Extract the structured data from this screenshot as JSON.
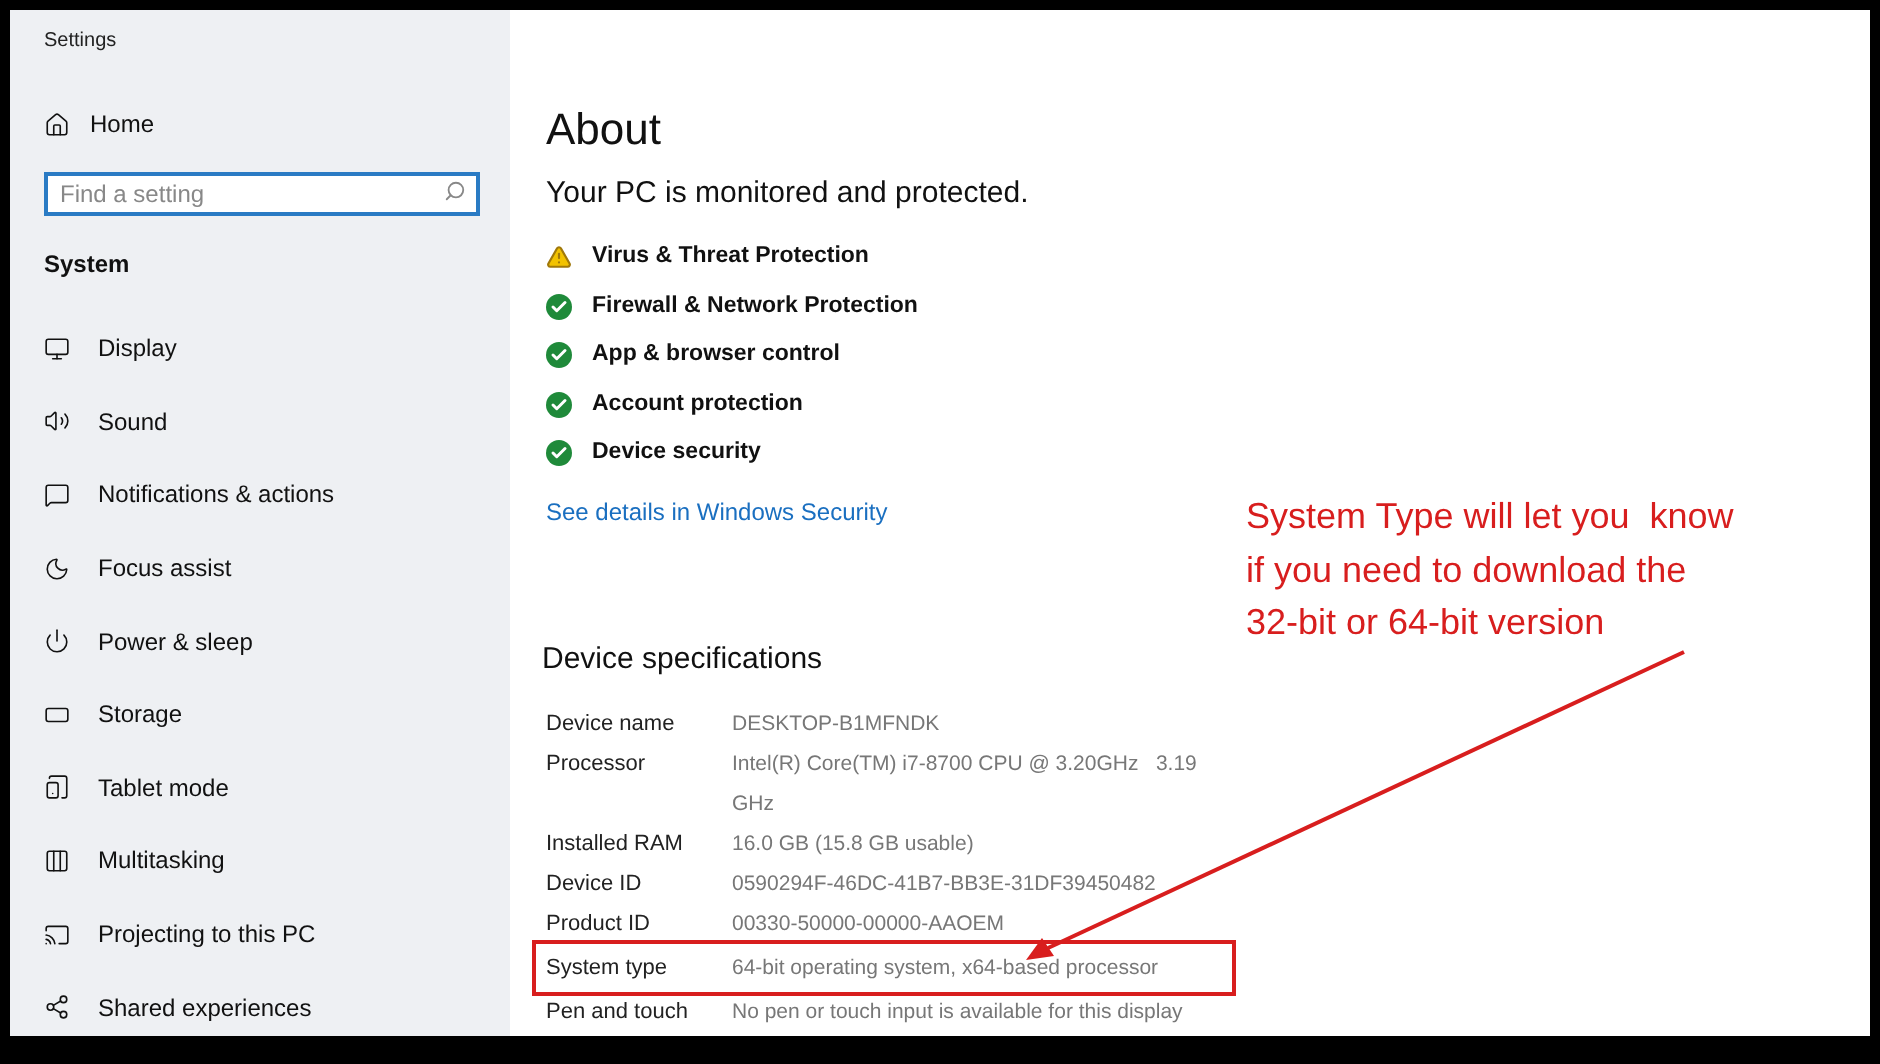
{
  "window": {
    "title": "Settings"
  },
  "sidebar": {
    "home": "Home",
    "search": {
      "placeholder": "Find a setting"
    },
    "section": "System",
    "items": [
      {
        "label": "Display"
      },
      {
        "label": "Sound"
      },
      {
        "label": "Notifications & actions"
      },
      {
        "label": "Focus assist"
      },
      {
        "label": "Power & sleep"
      },
      {
        "label": "Storage"
      },
      {
        "label": "Tablet mode"
      },
      {
        "label": "Multitasking"
      },
      {
        "label": "Projecting to this PC"
      },
      {
        "label": "Shared experiences"
      }
    ]
  },
  "main": {
    "title": "About",
    "status": "Your PC is monitored and protected.",
    "security": [
      {
        "label": "Virus & Threat Protection",
        "kind": "warning"
      },
      {
        "label": "Firewall & Network Protection",
        "kind": "ok"
      },
      {
        "label": "App & browser control",
        "kind": "ok"
      },
      {
        "label": "Account protection",
        "kind": "ok"
      },
      {
        "label": "Device security",
        "kind": "ok"
      }
    ],
    "link": "See details in Windows Security",
    "specs_title": "Device specifications",
    "specs": [
      {
        "label": "Device name",
        "value": "DESKTOP-B1MFNDK",
        "highlighted": false
      },
      {
        "label": "Processor",
        "value": "Intel(R) Core(TM) i7-8700 CPU @ 3.20GHz   3.19 GHz",
        "highlighted": false
      },
      {
        "label": "Installed RAM",
        "value": "16.0 GB (15.8 GB usable)",
        "highlighted": false
      },
      {
        "label": "Device ID",
        "value": "0590294F-46DC-41B7-BB3E-31DF39450482",
        "highlighted": false
      },
      {
        "label": "Product ID",
        "value": "00330-50000-00000-AAOEM",
        "highlighted": false
      },
      {
        "label": "System type",
        "value": "64-bit operating system, x64-based processor",
        "highlighted": true
      },
      {
        "label": "Pen and touch",
        "value": "No pen or touch input is available for this display",
        "highlighted": false
      }
    ]
  },
  "annotation": {
    "lines": [
      "System Type will let you  know",
      "if you need to download the",
      "32-bit or 64-bit version"
    ]
  }
}
